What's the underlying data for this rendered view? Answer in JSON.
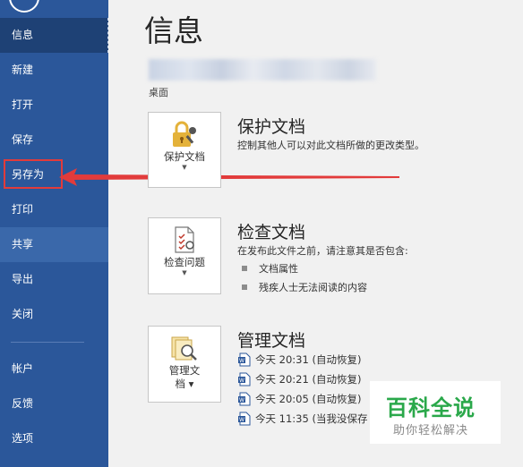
{
  "sidebar": {
    "items": [
      {
        "label": "信息"
      },
      {
        "label": "新建"
      },
      {
        "label": "打开"
      },
      {
        "label": "保存"
      },
      {
        "label": "另存为"
      },
      {
        "label": "打印"
      },
      {
        "label": "共享"
      },
      {
        "label": "导出"
      },
      {
        "label": "关闭"
      }
    ],
    "bottom_items": [
      {
        "label": "帐户"
      },
      {
        "label": "反馈"
      },
      {
        "label": "选项"
      }
    ]
  },
  "main": {
    "title": "信息",
    "location": "桌面",
    "protect": {
      "button_label": "保护文档",
      "title": "保护文档",
      "description": "控制其他人可以对此文档所做的更改类型。"
    },
    "inspect": {
      "button_label": "检查问题",
      "title": "检查文档",
      "description": "在发布此文件之前，请注意其是否包含:",
      "bullets": [
        "文档属性",
        "残疾人士无法阅读的内容"
      ]
    },
    "manage": {
      "button_label_line1": "管理文",
      "button_label_line2": "档",
      "title": "管理文档",
      "versions": [
        "今天 20:31 (自动恢复)",
        "今天 20:21 (自动恢复)",
        "今天 20:05 (自动恢复)",
        "今天 11:35 (当我没保存"
      ]
    }
  },
  "watermark": {
    "title": "百科全说",
    "subtitle": "助你轻松解决"
  },
  "colors": {
    "sidebar": "#2b579a",
    "sidebar_active": "#1e4175",
    "highlight": "#e23b3b",
    "watermark_green": "#2aa84a"
  }
}
